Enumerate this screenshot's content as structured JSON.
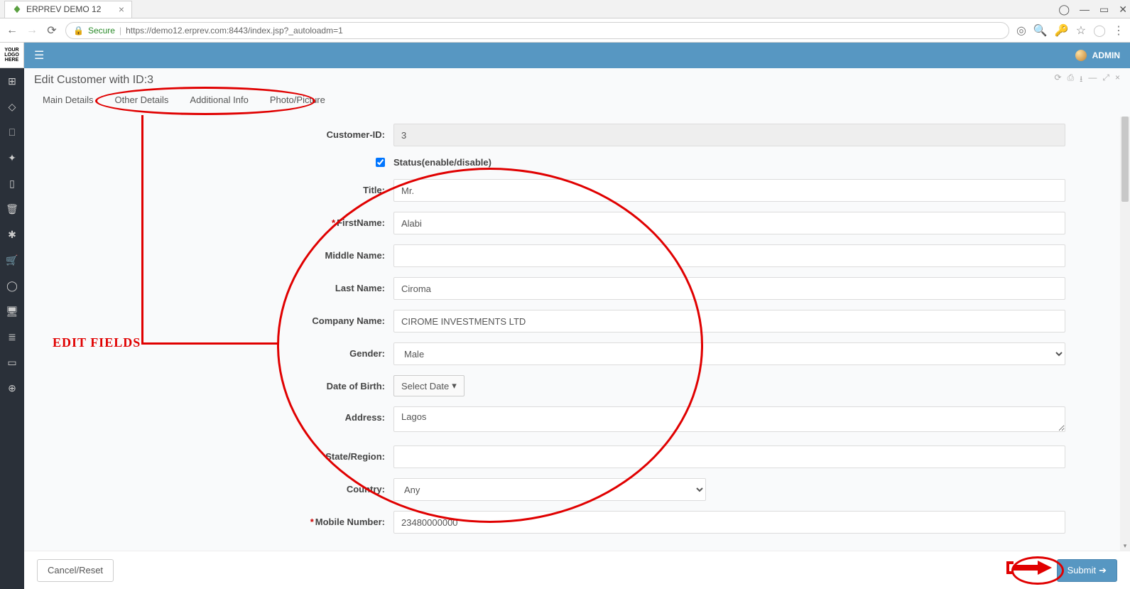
{
  "browser": {
    "tab_title": "ERPREV DEMO 12",
    "secure_label": "Secure",
    "url": "https://demo12.erprev.com:8443/index.jsp?_autoloadm=1"
  },
  "logo_text": "YOUR LOGO HERE",
  "topbar": {
    "user": "ADMIN"
  },
  "page_title": "Edit Customer with ID:3",
  "tabs": [
    {
      "label": "Main Details"
    },
    {
      "label": "Other Details"
    },
    {
      "label": "Additional Info"
    },
    {
      "label": "Photo/Picture"
    }
  ],
  "form": {
    "customer_id": {
      "label": "Customer-ID:",
      "value": "3"
    },
    "status": {
      "label": "Status(enable/disable)",
      "checked": true
    },
    "title": {
      "label": "Title:",
      "value": "Mr."
    },
    "first_name": {
      "label": "FirstName:",
      "value": "Alabi",
      "required": true
    },
    "middle_name": {
      "label": "Middle Name:",
      "value": ""
    },
    "last_name": {
      "label": "Last Name:",
      "value": "Ciroma"
    },
    "company_name": {
      "label": "Company Name:",
      "value": "CIROME INVESTMENTS LTD"
    },
    "gender": {
      "label": "Gender:",
      "value": "Male"
    },
    "dob": {
      "label": "Date of Birth:",
      "button": "Select Date"
    },
    "address": {
      "label": "Address:",
      "value": "Lagos"
    },
    "state_region": {
      "label": "State/Region:",
      "value": ""
    },
    "country": {
      "label": "Country:",
      "value": "Any"
    },
    "mobile": {
      "label": "Mobile Number:",
      "value": "23480000000",
      "required": true
    }
  },
  "footer": {
    "cancel": "Cancel/Reset",
    "submit": "Submit"
  },
  "annotation": {
    "label": "EDIT FIELDS"
  }
}
